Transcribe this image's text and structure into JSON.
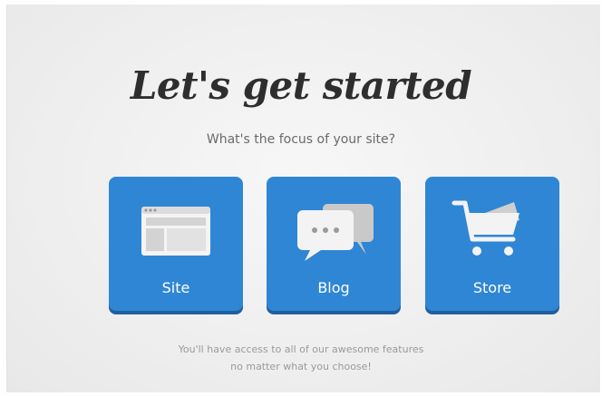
{
  "header": {
    "headline": "Let's get started",
    "subtitle": "What's the focus of your site?"
  },
  "options": [
    {
      "label": "Site",
      "icon": "website-window-icon"
    },
    {
      "label": "Blog",
      "icon": "chat-bubbles-icon"
    },
    {
      "label": "Store",
      "icon": "shopping-cart-icon"
    }
  ],
  "footnote": {
    "line1": "You'll have access to all of our awesome features",
    "line2": "no matter what you choose!"
  },
  "colors": {
    "tile": "#2f86d4",
    "tile_shadow": "#1f5f9f",
    "background": "#efefef"
  }
}
